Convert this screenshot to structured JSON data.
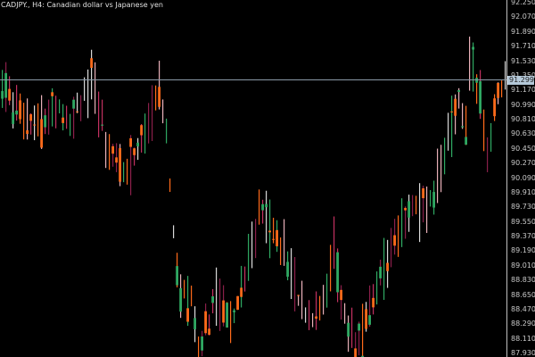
{
  "header": {
    "title": "CADJPY., H4:  Canadian dollar vs Japanese yen"
  },
  "colors": {
    "background": "#000000",
    "bars": [
      "#2fa862",
      "#ff6a1a",
      "#8a1f4a",
      "#e8b0b8",
      "#c23060",
      "#d9d9d9"
    ],
    "price_line": "#8a9aa8"
  },
  "chart_data": {
    "type": "bar",
    "title": "CADJPY., H4:  Canadian dollar vs Japanese yen",
    "ylim": [
      87.93,
      92.25
    ],
    "yticks": [
      "92.250",
      "92.070",
      "91.890",
      "91.710",
      "91.530",
      "91.350",
      "91.170",
      "90.990",
      "90.810",
      "90.630",
      "90.450",
      "90.270",
      "90.090",
      "89.910",
      "89.730",
      "89.550",
      "89.370",
      "89.190",
      "89.010",
      "88.830",
      "88.650",
      "88.470",
      "88.290",
      "88.110",
      "87.930"
    ],
    "current_price": "91.299",
    "path_prices": [
      91.2,
      91.0,
      90.7,
      91.0,
      90.8,
      91.3,
      90.6,
      90.1,
      90.5,
      91.2,
      90.6,
      88.8,
      88.6,
      88.0,
      88.6,
      88.4,
      89.3,
      89.7,
      89.5,
      89.2,
      88.6,
      88.3,
      88.6,
      89.3,
      88.6,
      88.0,
      88.2,
      88.8,
      89.2,
      89.8,
      89.6,
      90.0,
      90.6,
      91.0,
      90.6,
      91.5,
      91.1,
      90.4,
      91.1,
      91.3
    ],
    "path_bar_index": [
      0,
      5,
      10,
      15,
      19,
      25,
      29,
      34,
      39,
      44,
      46,
      49,
      53,
      55,
      60,
      65,
      70,
      73,
      75,
      79,
      83,
      86,
      90,
      93,
      95,
      99,
      101,
      105,
      110,
      114,
      118,
      121,
      125,
      128,
      130,
      131,
      134,
      136,
      139,
      141
    ]
  }
}
